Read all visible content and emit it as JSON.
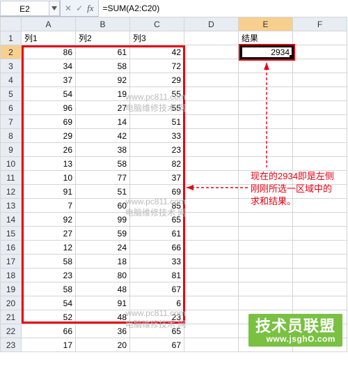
{
  "name_box": "E2",
  "formula": "=SUM(A2:C20)",
  "fx_label": "fx",
  "columns": [
    "A",
    "B",
    "C",
    "D",
    "E",
    "F"
  ],
  "rows": [
    1,
    2,
    3,
    4,
    5,
    6,
    7,
    8,
    9,
    10,
    11,
    12,
    13,
    14,
    15,
    16,
    17,
    18,
    19,
    20,
    21,
    22,
    23
  ],
  "headers_row1": {
    "A": "列1",
    "B": "列2",
    "C": "列3",
    "E": "结果"
  },
  "result_cell": "2934",
  "annotation": "现在的2934即是左侧\n刚刚所选一区域中的\n求和结果。",
  "watermark_line1": "www.pc811.com",
  "watermark_line2": "电脑维修技术 网",
  "logo_big": "技术员联盟",
  "logo_small": "www.jsghO.com",
  "chart_data": {
    "type": "table",
    "columns": [
      "列1",
      "列2",
      "列3"
    ],
    "rows": [
      [
        86,
        61,
        42
      ],
      [
        34,
        58,
        72
      ],
      [
        37,
        92,
        29
      ],
      [
        54,
        19,
        55
      ],
      [
        96,
        27,
        55
      ],
      [
        69,
        14,
        51
      ],
      [
        29,
        42,
        33
      ],
      [
        26,
        38,
        23
      ],
      [
        13,
        58,
        82
      ],
      [
        10,
        77,
        37
      ],
      [
        91,
        51,
        69
      ],
      [
        7,
        60,
        85
      ],
      [
        92,
        99,
        65
      ],
      [
        27,
        59,
        61
      ],
      [
        12,
        24,
        66
      ],
      [
        58,
        18,
        33
      ],
      [
        23,
        80,
        81
      ],
      [
        58,
        48,
        67
      ],
      [
        54,
        91,
        6
      ],
      [
        52,
        48,
        23
      ],
      [
        66,
        36,
        65
      ],
      [
        17,
        20,
        67
      ]
    ],
    "sum_A2_C20": 2934
  }
}
